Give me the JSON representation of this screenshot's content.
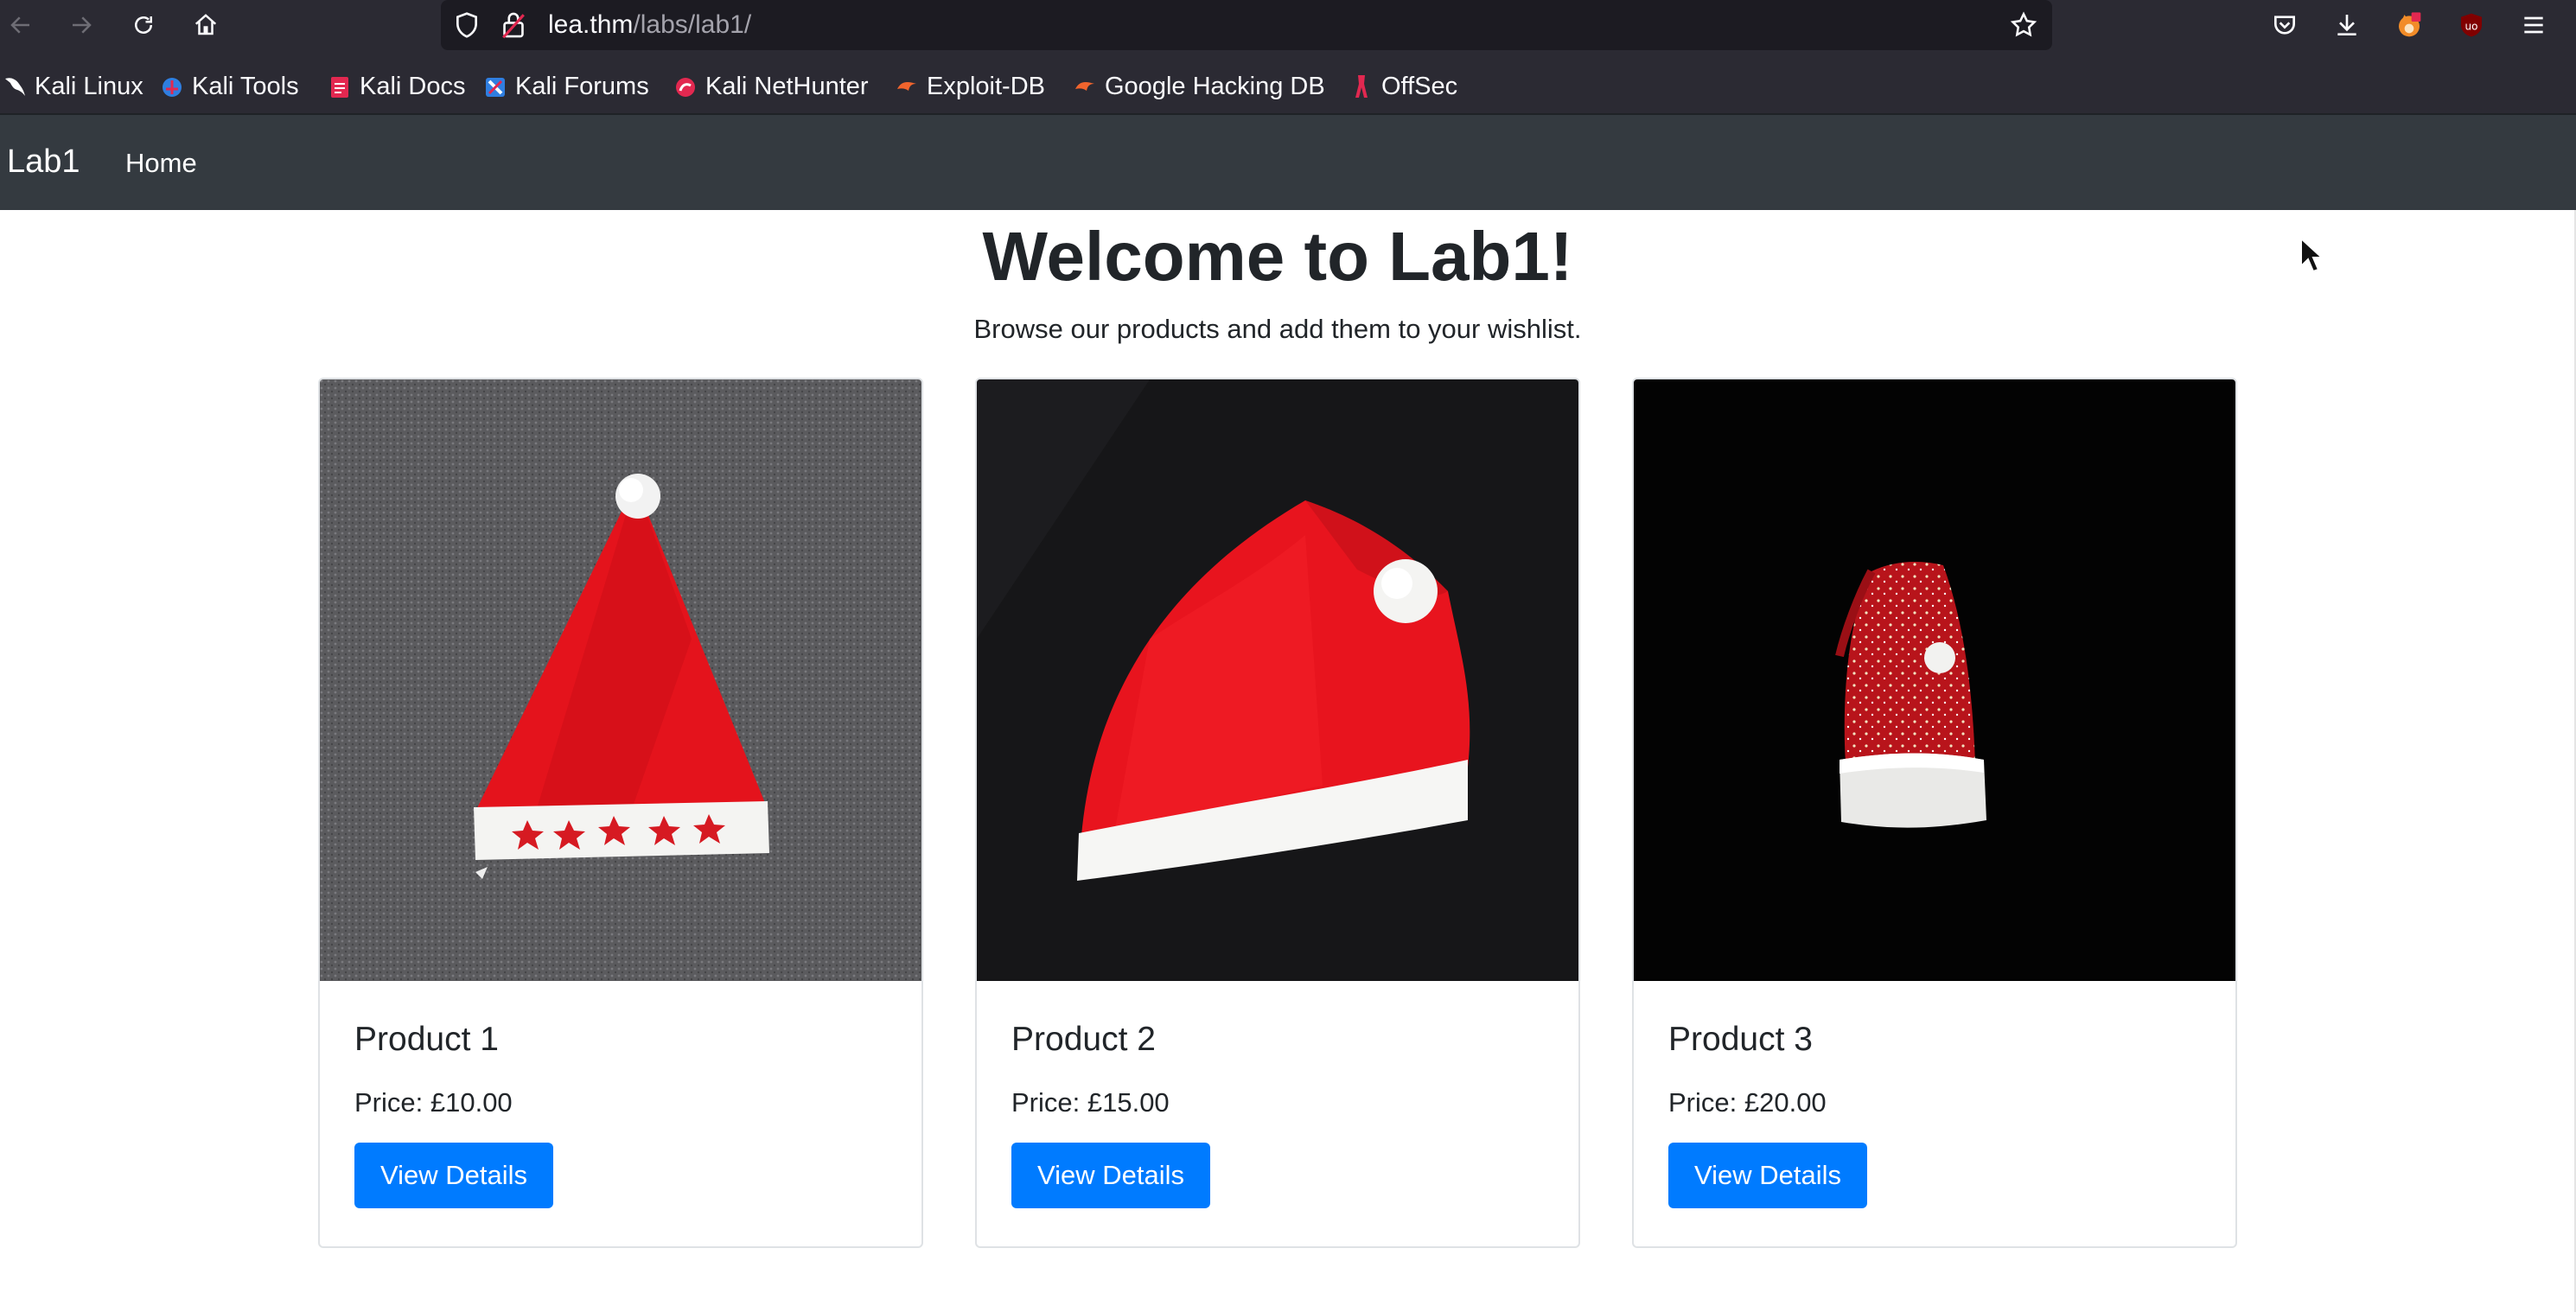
{
  "browser": {
    "url_host": "lea.thm",
    "url_path": "/labs/lab1/",
    "bookmarks": [
      "Kali Linux",
      "Kali Tools",
      "Kali Docs",
      "Kali Forums",
      "Kali NetHunter",
      "Exploit-DB",
      "Google Hacking DB",
      "OffSec"
    ],
    "icons": {
      "back": "arrow-left-icon",
      "forward": "arrow-right-icon",
      "reload": "reload-icon",
      "home": "home-icon",
      "tracking": "shield-icon",
      "security": "lock-icon",
      "bookmark": "star-icon",
      "pocket": "pocket-icon",
      "downloads": "download-icon",
      "extension1": "foxyproxy-icon",
      "extension2": "ublock-icon",
      "menu": "hamburger-menu-icon"
    }
  },
  "site": {
    "brand": "Lab1",
    "nav": [
      "Home"
    ]
  },
  "hero": {
    "title": "Welcome to Lab1!",
    "subtitle": "Browse our products and add them to your wishlist."
  },
  "products": [
    {
      "name": "Product 1",
      "price": "Price: £10.00",
      "button": "View Details"
    },
    {
      "name": "Product 2",
      "price": "Price: £15.00",
      "button": "View Details"
    },
    {
      "name": "Product 3",
      "price": "Price: £20.00",
      "button": "View Details"
    }
  ],
  "colors": {
    "chrome_bg": "#2b2a33",
    "navbar_bg": "#343a40",
    "primary_button": "#007bff",
    "text": "#212529"
  }
}
